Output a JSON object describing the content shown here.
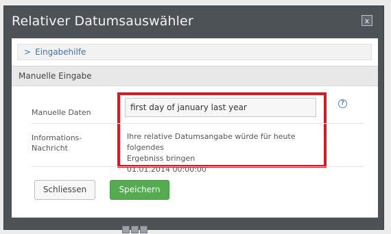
{
  "dialog": {
    "title": "Relativer Datumsauswähler",
    "close_label": "x"
  },
  "helper": {
    "chevron": ">",
    "label": "Eingabehilfe"
  },
  "section": {
    "title": "Manuelle Eingabe"
  },
  "form": {
    "manual_label": "Manuelle Daten",
    "manual_value": "first day of january last year",
    "info_label_line1": "Informations-",
    "info_label_line2": "Nachricht",
    "info_line1": "Ihre relative Datumsangabe würde für heute folgendes",
    "info_line2": "Ergebniss bringen",
    "info_line3": "01.01.2014 00:00:00"
  },
  "buttons": {
    "close": "Schliessen",
    "save": "Speichern"
  },
  "colors": {
    "highlight": "#e0151f",
    "save_button": "#53ad4e",
    "dialog_frame": "#4d5257"
  }
}
